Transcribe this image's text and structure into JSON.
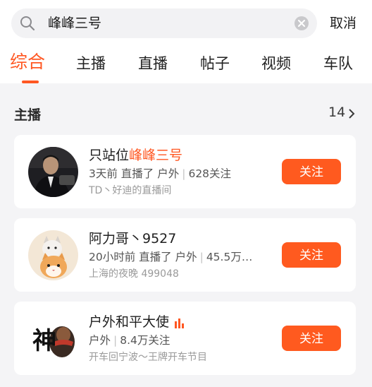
{
  "search": {
    "query": "峰峰三号",
    "cancel_label": "取消"
  },
  "tabs": [
    {
      "label": "综合",
      "active": true
    },
    {
      "label": "主播"
    },
    {
      "label": "直播"
    },
    {
      "label": "帖子"
    },
    {
      "label": "视频"
    },
    {
      "label": "车队"
    }
  ],
  "section": {
    "title": "主播",
    "count": "14"
  },
  "streamers": [
    {
      "name_prefix": "只站位",
      "name_highlight": "峰峰三号",
      "meta_status": "3天前 直播了 户外",
      "meta_followers": "628关注",
      "sub": "TD丶好迪的直播间",
      "follow_label": "关注"
    },
    {
      "name_prefix": "阿力哥丶9527",
      "name_highlight": "",
      "meta_status": "20小时前 直播了 户外",
      "meta_followers": "45.5万…",
      "sub": "上海的夜晚 499048",
      "follow_label": "关注"
    },
    {
      "name_prefix": "户外和平大使",
      "name_highlight": "",
      "meta_status": "户外",
      "meta_followers": "8.4万关注",
      "sub": "开车回宁波～王牌开车节目",
      "follow_label": "关注",
      "avatar_text": "神",
      "live": true
    }
  ],
  "colors": {
    "accent": "#ff5722",
    "button": "#ff5a1f"
  }
}
